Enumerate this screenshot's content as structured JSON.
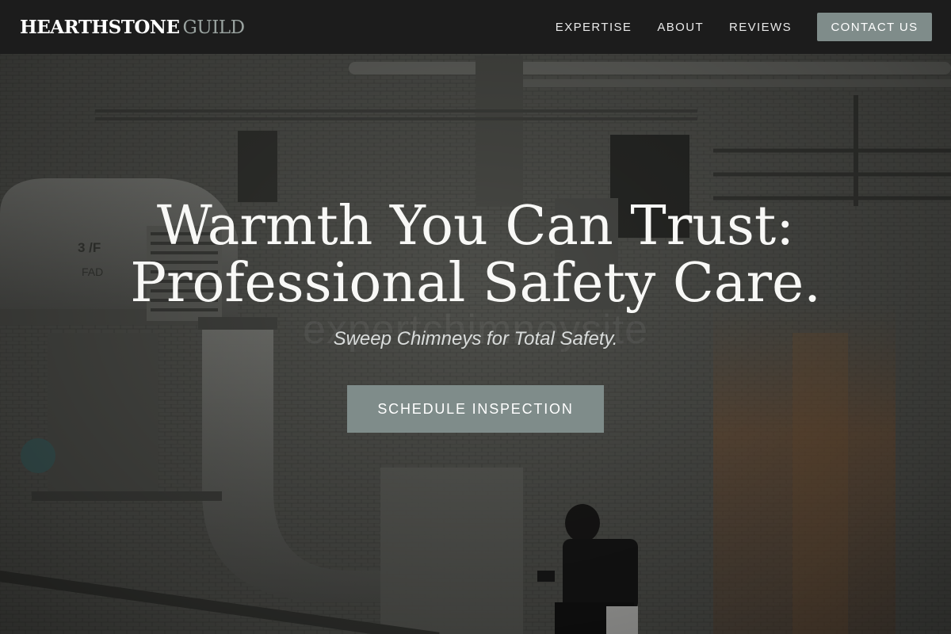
{
  "brand": {
    "primary": "HEARTHSTONE",
    "secondary": "GUILD"
  },
  "nav": {
    "items": [
      "EXPERTISE",
      "ABOUT",
      "REVIEWS"
    ],
    "contact_label": "CONTACT US"
  },
  "hero": {
    "headline_line1": "Warmth You Can Trust:",
    "headline_line2": "Professional Safety Care.",
    "watermark": "expertchimneysite",
    "subtitle": "Sweep Chimneys for Total Safety.",
    "cta_label": "SCHEDULE INSPECTION",
    "duct_marking_1": "3 /F",
    "duct_marking_2": "FAD"
  },
  "colors": {
    "navbar_bg": "#1c1c1c",
    "accent": "#7f8c8a",
    "brand_secondary": "#9aa3a0",
    "text": "#ffffff"
  }
}
